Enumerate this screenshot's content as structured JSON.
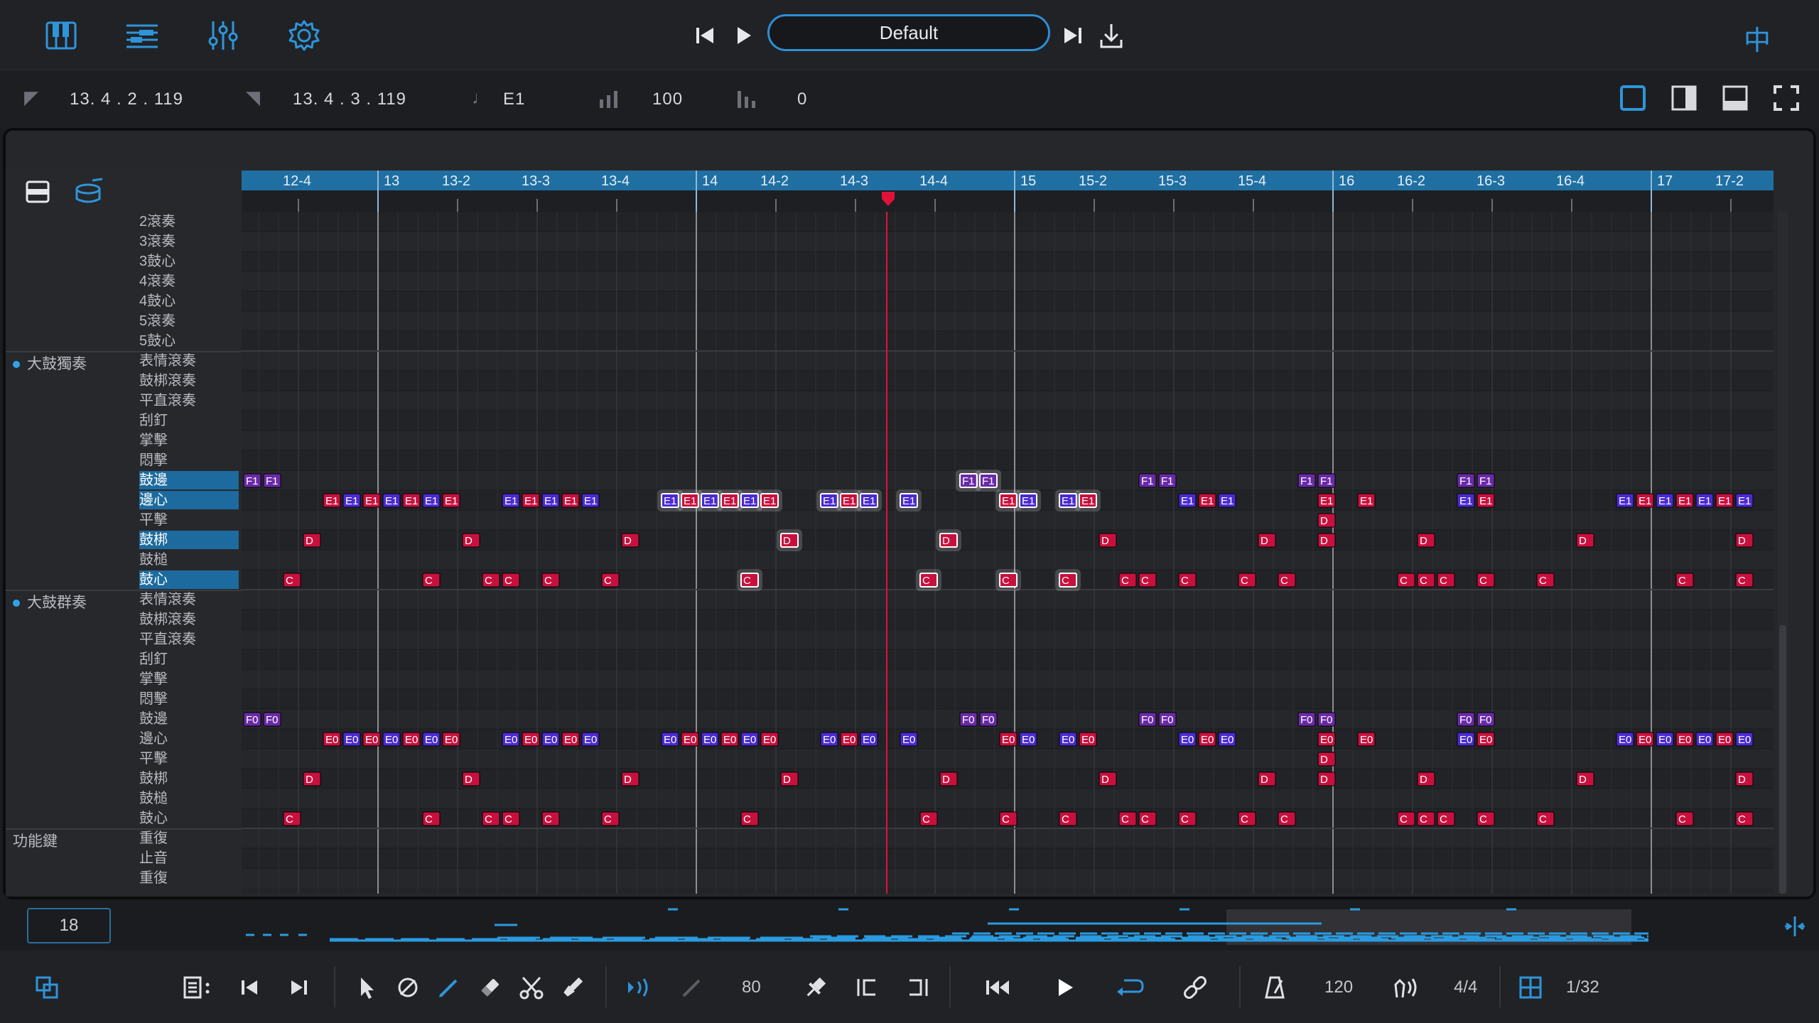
{
  "topbar": {
    "preset_name": "Default",
    "right_glyph": "中",
    "icons": [
      "piano-icon",
      "tracks-icon",
      "mixer-icon",
      "gear-icon"
    ]
  },
  "infobar": {
    "start_pos": "13. 4 . 2 . 119",
    "end_pos": "13. 4 . 3 . 119",
    "note": "E1",
    "velocity": "100",
    "offset": "0"
  },
  "ruler": {
    "labels": [
      {
        "t": "12-4",
        "beat": 0
      },
      {
        "t": "13",
        "beat": 1
      },
      {
        "t": "13-2",
        "beat": 2
      },
      {
        "t": "13-3",
        "beat": 3
      },
      {
        "t": "13-4",
        "beat": 4
      },
      {
        "t": "14",
        "beat": 5
      },
      {
        "t": "14-2",
        "beat": 6
      },
      {
        "t": "14-3",
        "beat": 7
      },
      {
        "t": "14-4",
        "beat": 8
      },
      {
        "t": "15",
        "beat": 9
      },
      {
        "t": "15-2",
        "beat": 10
      },
      {
        "t": "15-3",
        "beat": 11
      },
      {
        "t": "15-4",
        "beat": 12
      },
      {
        "t": "16",
        "beat": 13
      },
      {
        "t": "16-2",
        "beat": 14
      },
      {
        "t": "16-3",
        "beat": 15
      },
      {
        "t": "16-4",
        "beat": 16
      },
      {
        "t": "17",
        "beat": 17
      },
      {
        "t": "17-2",
        "beat": 18
      }
    ]
  },
  "groups": [
    {
      "label": "大鼓獨奏",
      "dot": true,
      "row": 7
    },
    {
      "label": "大鼓群奏",
      "dot": true,
      "row": 19
    },
    {
      "label": "功能鍵",
      "dot": false,
      "row": 31
    }
  ],
  "rows": [
    {
      "label": "2滾奏"
    },
    {
      "label": "3滾奏"
    },
    {
      "label": "3鼓心"
    },
    {
      "label": "4滾奏"
    },
    {
      "label": "4鼓心"
    },
    {
      "label": "5滾奏"
    },
    {
      "label": "5鼓心"
    },
    {
      "label": "表情滾奏"
    },
    {
      "label": "鼓梆滾奏"
    },
    {
      "label": "平直滾奏"
    },
    {
      "label": "刮釘"
    },
    {
      "label": "掌擊"
    },
    {
      "label": "悶擊"
    },
    {
      "label": "鼓邊",
      "hl": true
    },
    {
      "label": "邊心",
      "hl": true
    },
    {
      "label": "平擊"
    },
    {
      "label": "鼓梆",
      "hl": true
    },
    {
      "label": "鼓槌"
    },
    {
      "label": "鼓心",
      "hl": true
    },
    {
      "label": "表情滾奏"
    },
    {
      "label": "鼓梆滾奏"
    },
    {
      "label": "平直滾奏"
    },
    {
      "label": "刮釘"
    },
    {
      "label": "掌擊"
    },
    {
      "label": "悶擊"
    },
    {
      "label": "鼓邊"
    },
    {
      "label": "邊心"
    },
    {
      "label": "平擊"
    },
    {
      "label": "鼓梆"
    },
    {
      "label": "鼓槌"
    },
    {
      "label": "鼓心"
    },
    {
      "label": "重復"
    },
    {
      "label": "止音"
    },
    {
      "label": "重復"
    }
  ],
  "notes": {
    "solo": {
      "F": [
        0,
        0.25,
        9.0,
        9.25,
        11.25,
        11.5,
        13.25,
        13.5,
        15.25,
        15.5
      ],
      "E": [
        1.0,
        1.25,
        1.5,
        1.75,
        2.0,
        2.25,
        2.5,
        3.25,
        3.5,
        3.75,
        4.0,
        4.25,
        5.25,
        5.5,
        5.75,
        6.0,
        6.25,
        6.5,
        7.25,
        7.5,
        7.75,
        8.25,
        9.5,
        9.75,
        10.25,
        10.5,
        11.75,
        12.0,
        12.25,
        13.5,
        14.0,
        15.25,
        15.5,
        17.25,
        17.5,
        17.75,
        18.0,
        18.25,
        18.5,
        18.75
      ],
      "Dlow": [
        13.5
      ],
      "D": [
        0.75,
        2.75,
        4.75,
        6.75,
        8.75,
        10.75,
        12.75,
        13.5,
        14.75,
        16.75,
        18.75
      ],
      "C": [
        0.5,
        2.25,
        3.0,
        3.25,
        3.75,
        4.5,
        6.25,
        8.5,
        9.5,
        10.25,
        11.0,
        11.25,
        11.75,
        12.5,
        13.0,
        14.5,
        14.75,
        15.0,
        15.5,
        16.25,
        18.0,
        18.75
      ]
    },
    "hot_E": [
      5.25,
      5.5,
      5.75,
      6.0,
      6.25,
      6.5,
      7.25,
      7.5,
      7.75,
      8.25,
      9.5,
      9.75,
      10.25,
      10.5
    ],
    "hot_F": [
      9.0,
      9.25
    ],
    "hot_D": [
      6.75,
      8.75
    ],
    "hot_C": [
      6.25,
      8.5,
      9.5,
      10.25
    ]
  },
  "playhead_beat": 7.25,
  "bottom": {
    "bar_number": "18",
    "velocity_value": "80",
    "tempo": "120",
    "time_sig": "4/4",
    "quantize": "1/32"
  },
  "colors": {
    "accent": "#2ea3ea",
    "ruler_bg": "#1f6fa3",
    "note_red": "#c8103e",
    "note_purple": "#6a2aa8",
    "note_blue": "#4a2ad0",
    "playhead": "#e0123a"
  }
}
